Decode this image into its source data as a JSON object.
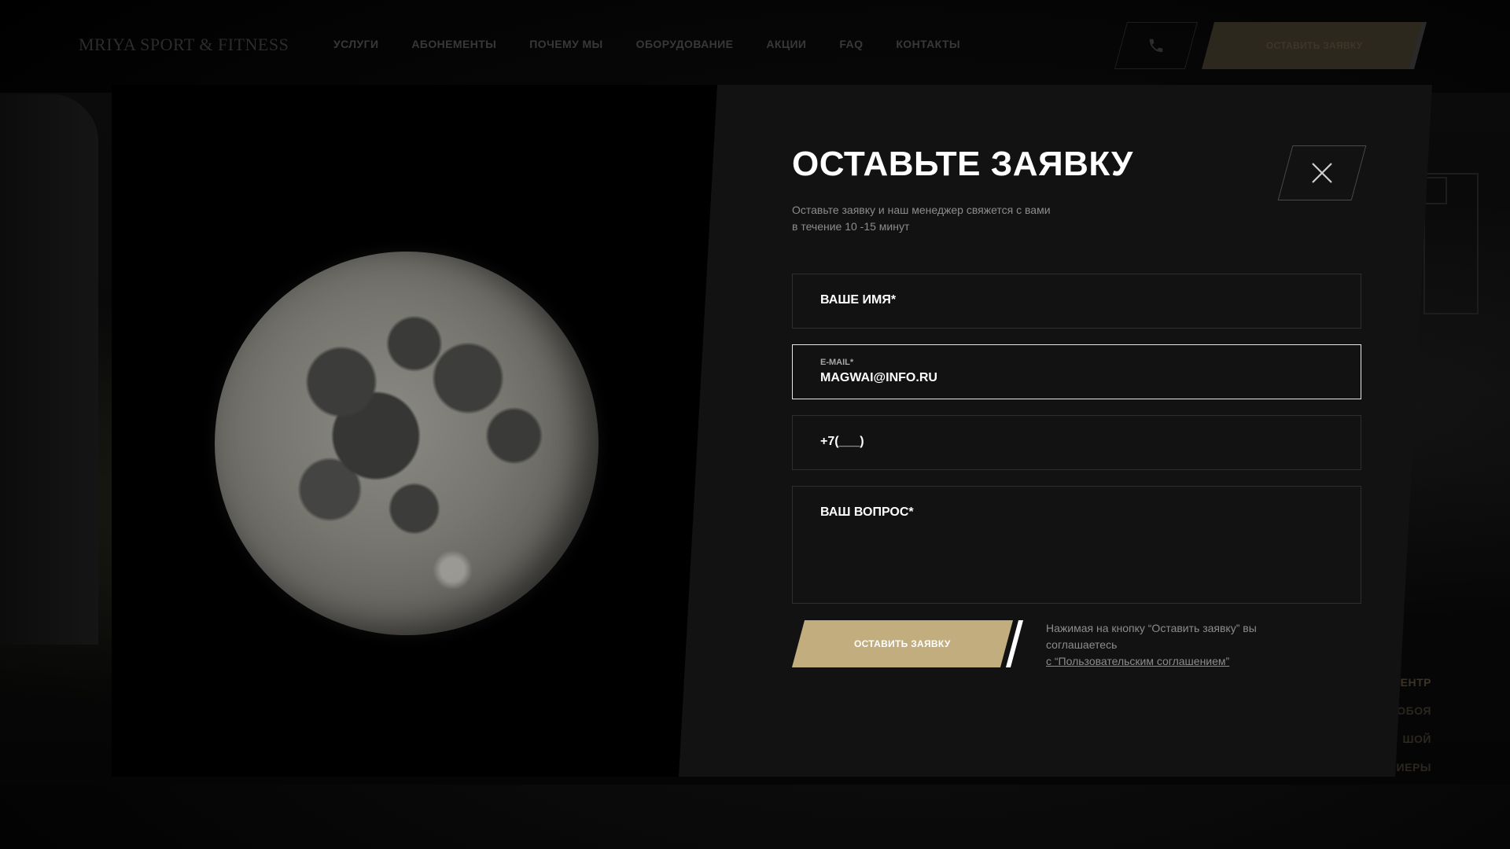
{
  "header": {
    "logo": "MRIYA SPORT & FITNESS",
    "nav": [
      "УСЛУГИ",
      "АБОНЕМЕНТЫ",
      "ПОЧЕМУ МЫ",
      "ОБОРУДОВАНИЕ",
      "АКЦИИ",
      "FAQ",
      "КОНТАКТЫ"
    ],
    "phone_icon": "phone-icon",
    "cta_label": "ОСТАВИТЬ ЗАЯВКУ"
  },
  "background": {
    "side_menu": [
      "ЕНТР",
      "ОБОЯ",
      "ШОЙ",
      "ИЕРЫ"
    ]
  },
  "modal": {
    "title": "ОСТАВЬТЕ ЗАЯВКУ",
    "subtitle_line1": "Оставьте заявку и наш менеджер свяжется с вами",
    "subtitle_line2": "в течение 10 -15 минут",
    "close_icon": "close-icon",
    "fields": {
      "name_placeholder": "ВАШЕ ИМЯ*",
      "email_label": "E-MAIL*",
      "email_value": "MAGWAI@INFO.RU",
      "phone_placeholder": "+7(___)",
      "question_placeholder": "ВАШ ВОПРОС*"
    },
    "submit_label": "ОСТАВИТЬ ЗАЯВКУ",
    "consent_text": "Нажимая на кнопку “Оставить заявку” вы соглашаетесь",
    "consent_link": "с “Пользовательским соглашением”"
  },
  "colors": {
    "accent": "#c2ad7e",
    "modal_bg": "#121212",
    "page_bg": "#000000"
  }
}
